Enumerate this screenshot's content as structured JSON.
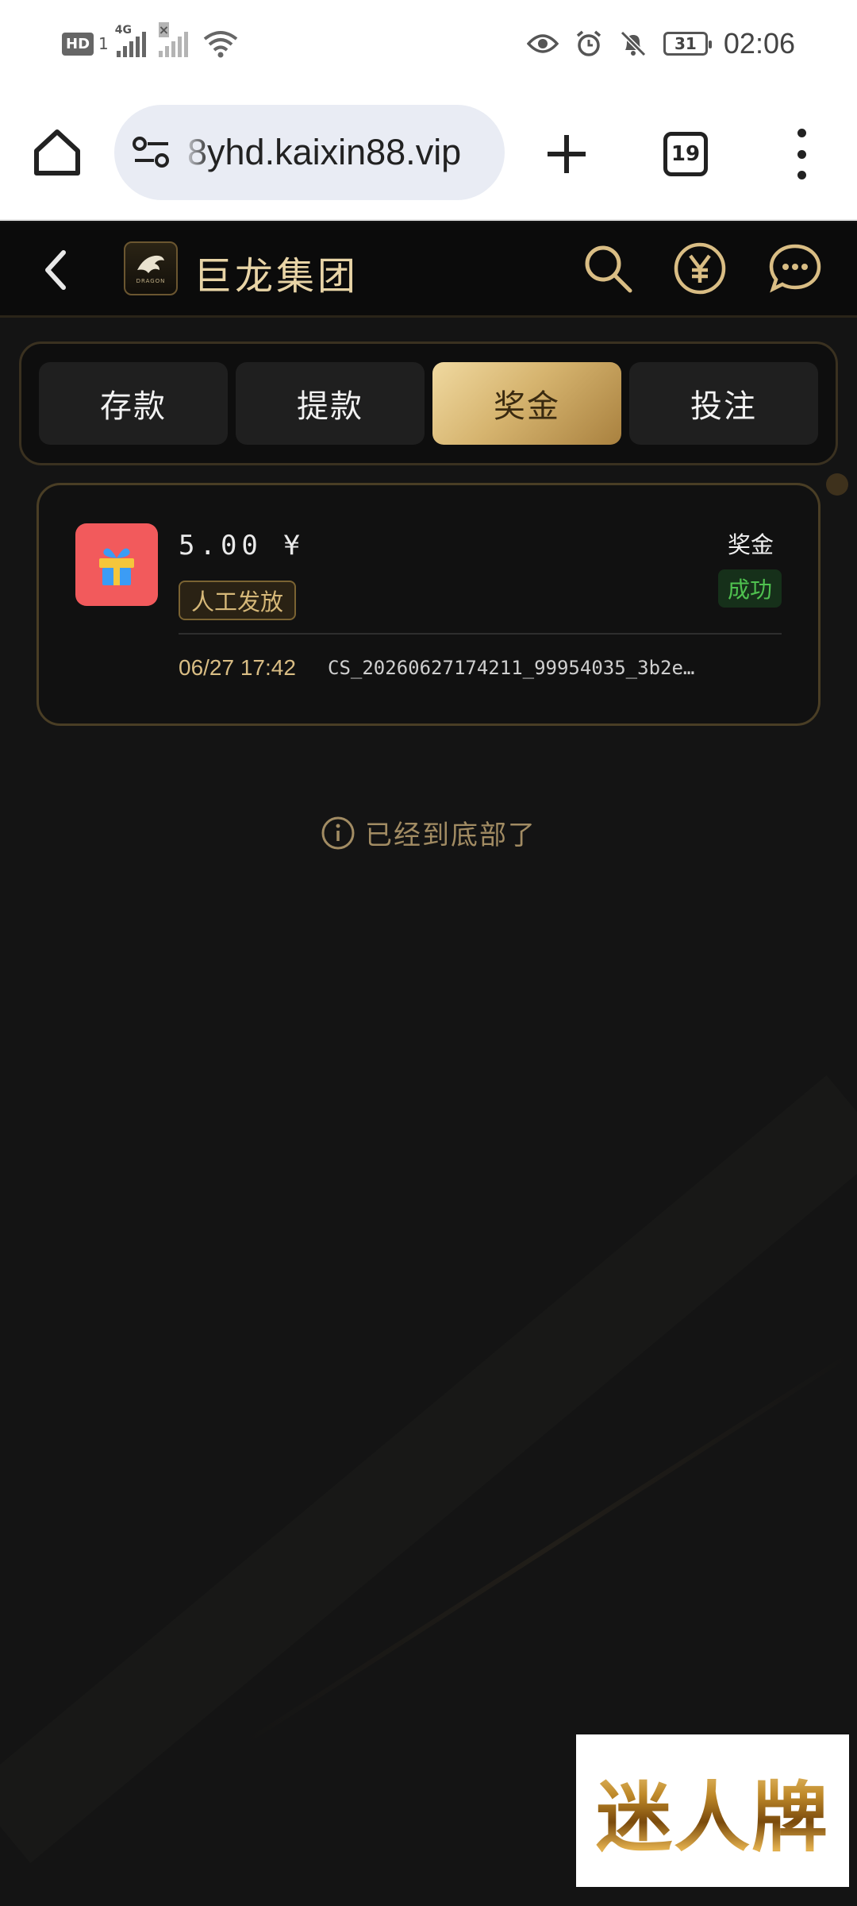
{
  "status_bar": {
    "left": {
      "hd": "HD",
      "hd_sub": "1",
      "network": "4G",
      "sim2_mark": "×"
    },
    "right": {
      "battery": "31",
      "time": "02:06"
    }
  },
  "browser": {
    "url": "8yhd.kaixin88.vip",
    "tab_count": "19",
    "icons": [
      "home-icon",
      "tune-icon",
      "plus-icon",
      "tab-switcher-icon",
      "more-vert-icon"
    ]
  },
  "app": {
    "title": "巨龙集团",
    "logo_text": "DRAGON",
    "icons": [
      "back-icon",
      "search-icon",
      "yuan-icon",
      "chat-icon"
    ]
  },
  "tabs": [
    {
      "label": "存款",
      "active": false
    },
    {
      "label": "提款",
      "active": false
    },
    {
      "label": "奖金",
      "active": true
    },
    {
      "label": "投注",
      "active": false
    }
  ],
  "records": [
    {
      "icon": "gift-icon",
      "amount": "5.00 ¥",
      "method": "人工发放",
      "type": "奖金",
      "status": "成功",
      "date": "06/27 17:42",
      "txid": "CS_20260627174211_99954035_3b2e…"
    }
  ],
  "end_message": "已经到底部了",
  "overlay_ad": {
    "text": "迷人牌"
  },
  "colors": {
    "gold_accent": "#d6b46f",
    "background": "#141414",
    "success_green": "#4fc24f",
    "gift_red": "#f25a5c"
  }
}
